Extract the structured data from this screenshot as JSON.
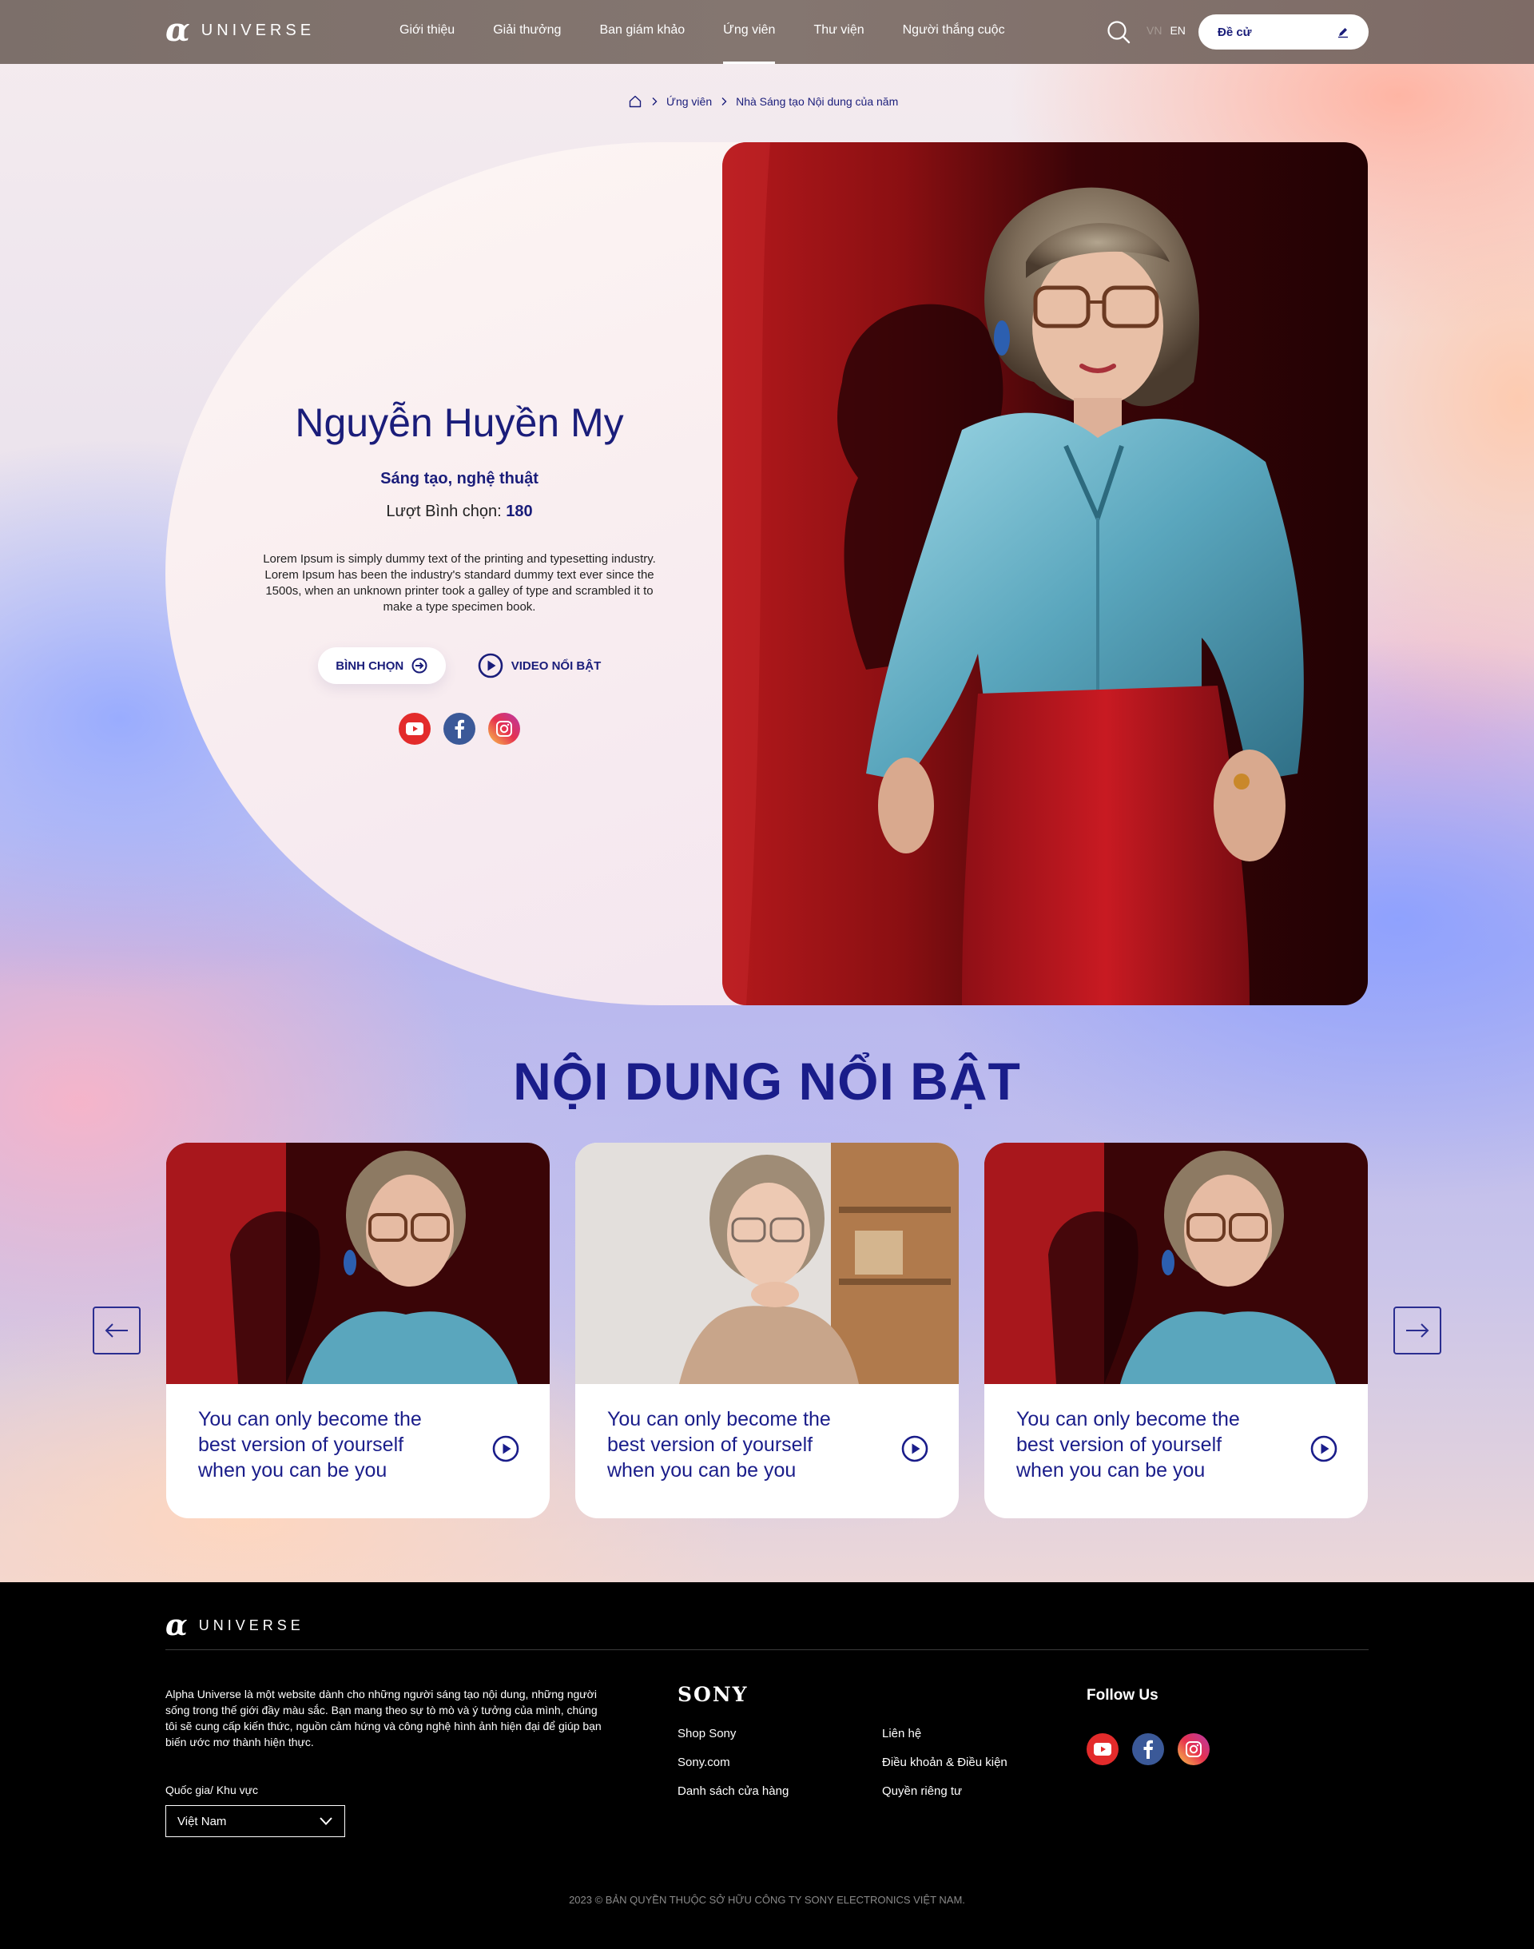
{
  "header": {
    "logo_symbol": "α",
    "logo_word": "UNIVERSE",
    "nav": [
      "Giới thiệu",
      "Giải thưởng",
      "Ban giám khảo",
      "Ứng viên",
      "Thư viện",
      "Người thắng cuộc"
    ],
    "active_nav": "Ứng viên",
    "lang_vn": "VN",
    "lang_en": "EN",
    "nominate_label": "Đề cử",
    "icons": {
      "search": "search-icon",
      "nominate": "pencil-icon"
    }
  },
  "breadcrumb": {
    "items": [
      "Ứng viên",
      "Nhà Sáng tạo Nội dung của năm"
    ],
    "home_icon": "home-icon"
  },
  "hero": {
    "name": "Nguyễn Huyền My",
    "category": "Sáng tạo, nghệ thuật",
    "votes_label": "Lượt Bình chọn:",
    "votes_value": "180",
    "description": "Lorem Ipsum is simply dummy text of the printing and typesetting industry. Lorem Ipsum has been the industry's standard dummy text ever since the 1500s, when an unknown printer took a galley of type and scrambled it to make a type specimen book.",
    "vote_button": "BÌNH CHỌN",
    "video_link": "VIDEO NỔI BẬT",
    "socials": [
      "youtube-icon",
      "facebook-icon",
      "instagram-icon"
    ]
  },
  "featured": {
    "title": "NỘI DUNG NỔI BẬT",
    "cards": [
      {
        "caption": "You can only become the best version of yourself when you can be you"
      },
      {
        "caption": "You can only become the best version of yourself when you can be you"
      },
      {
        "caption": "You can only become the best version of yourself when you can be you"
      }
    ],
    "prev_icon": "arrow-left-icon",
    "next_icon": "arrow-right-icon"
  },
  "footer": {
    "logo_symbol": "α",
    "logo_word": "UNIVERSE",
    "about": "Alpha Universe là một website dành cho những người sáng tạo nội dung, những người sống trong thế giới đầy màu sắc. Bạn mang theo sự tò mò và ý tưởng của mình, chúng tôi sẽ cung cấp kiến thức, nguồn cảm hứng và công nghệ hình ảnh hiện đại để giúp bạn biến ước mơ thành hiện thực.",
    "country_label": "Quốc gia/ Khu vực",
    "country_value": "Việt Nam",
    "brand": "SONY",
    "links_col1": [
      "Shop Sony",
      "Sony.com",
      "Danh sách cửa hàng"
    ],
    "links_col2": [
      "Liên hệ",
      "Điều khoản & Điều kiện",
      "Quyền riêng tư"
    ],
    "follow_label": "Follow Us",
    "copyright": "2023 © BẢN QUYỀN THUỘC SỞ HỮU CÔNG TY SONY ELECTRONICS VIỆT NAM."
  },
  "colors": {
    "primary": "#1a1d7a",
    "header_bg": "#7c6f6a",
    "youtube": "#e32b2b",
    "facebook": "#3b5998"
  }
}
